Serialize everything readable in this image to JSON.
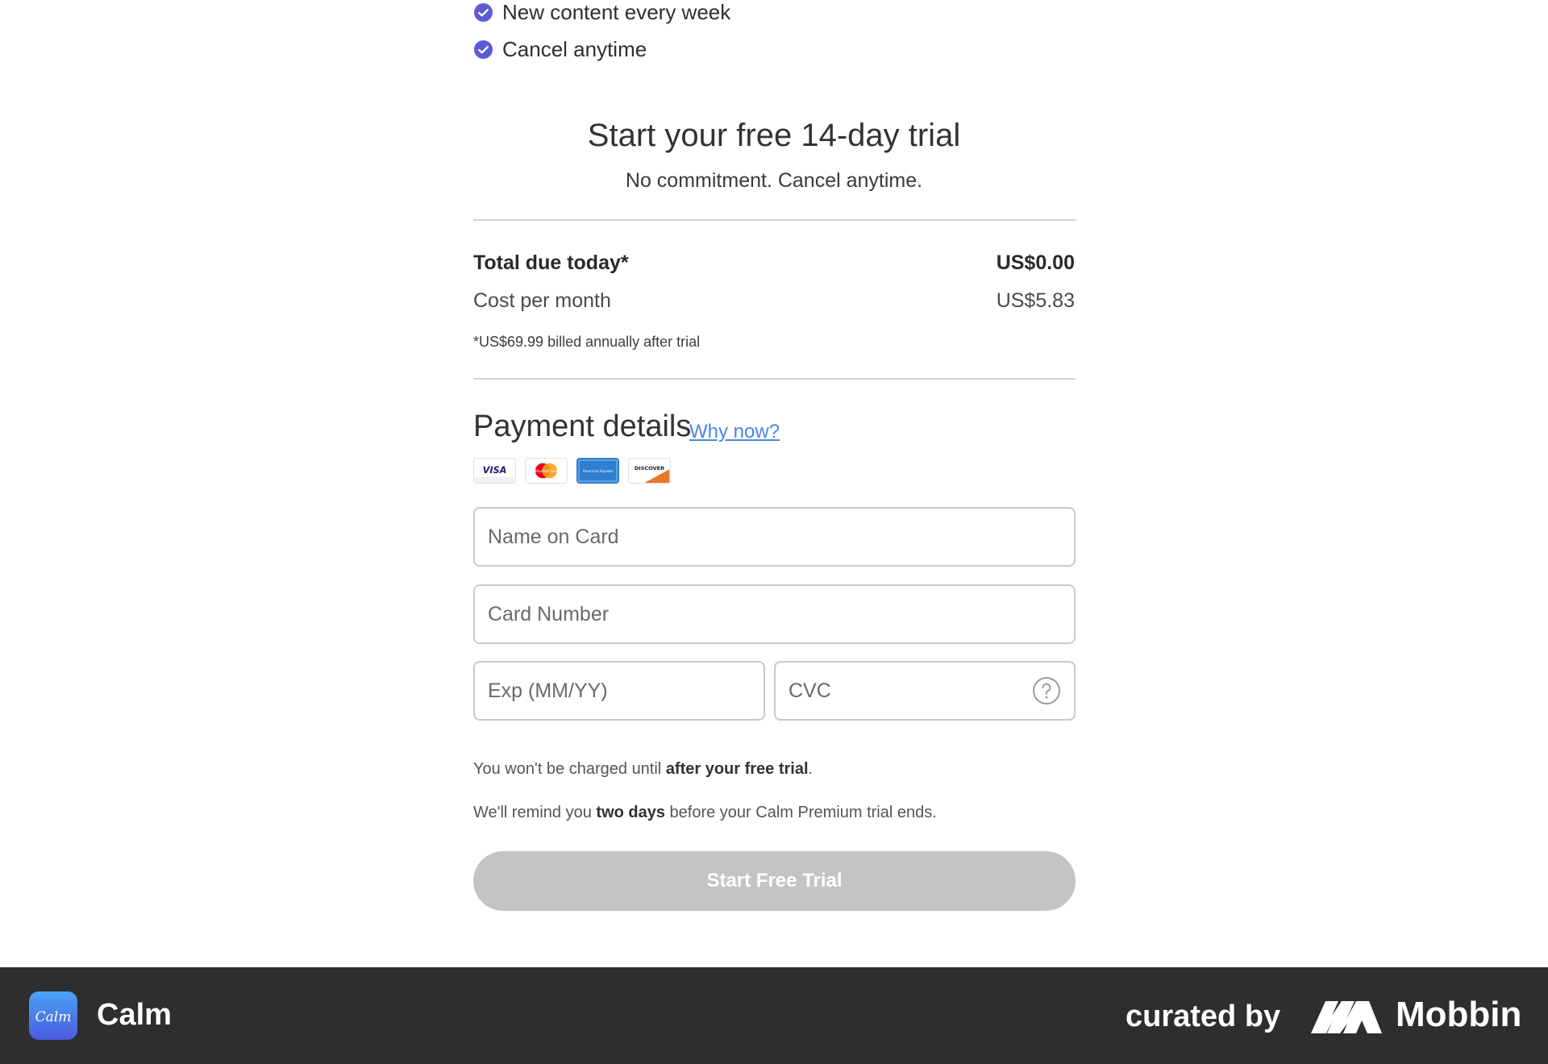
{
  "features": [
    {
      "label": "New content every week",
      "icon": "check-circle-icon"
    },
    {
      "label": "Cancel anytime",
      "icon": "check-circle-icon"
    }
  ],
  "trial": {
    "title": "Start your free 14-day trial",
    "subtitle": "No commitment. Cancel anytime."
  },
  "summary": {
    "total_label": "Total due today*",
    "total_value": "US$0.00",
    "monthly_label": "Cost per month",
    "monthly_value": "US$5.83",
    "footnote": "*US$69.99 billed annually after trial"
  },
  "payment": {
    "title": "Payment details",
    "why_link": "Why now?",
    "card_brands": [
      "VISA",
      "MasterCard",
      "American Express",
      "DISCOVER"
    ],
    "name_placeholder": "Name on Card",
    "number_placeholder": "Card Number",
    "exp_placeholder": "Exp (MM/YY)",
    "cvc_placeholder": "CVC",
    "cvc_help_icon": "question-circle-icon"
  },
  "notes": {
    "charge_prefix": "You won't be charged until ",
    "charge_bold": "after your free trial",
    "charge_suffix": ".",
    "remind_prefix": "We'll remind you ",
    "remind_bold": "two days",
    "remind_suffix": " before your Calm Premium trial ends."
  },
  "cta": {
    "label": "Start Free Trial"
  },
  "footer": {
    "app_name": "Calm",
    "app_icon_text": "Calm",
    "curated_by": "curated by",
    "brand": "Mobbin"
  },
  "colors": {
    "accent": "#5b5bd6",
    "link": "#4a86e8",
    "cta_disabled": "#c4c4c4",
    "footer_bg": "#2e2e2e"
  }
}
